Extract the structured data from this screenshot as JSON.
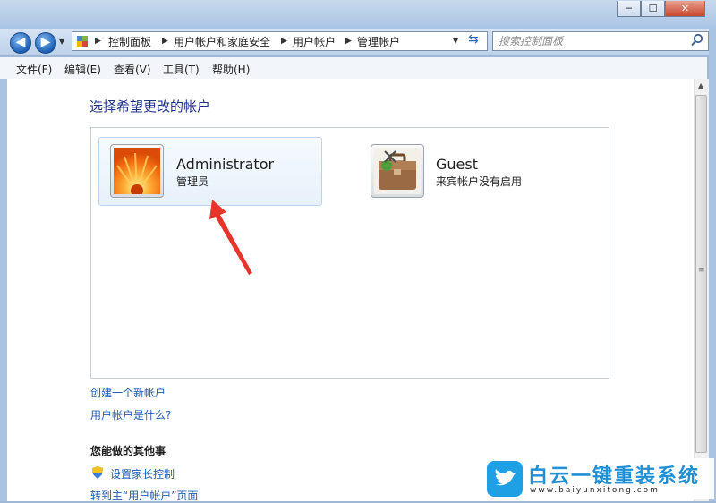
{
  "window": {
    "controls": {
      "minimize": "─",
      "maximize": "☐",
      "close": "✕"
    }
  },
  "nav": {
    "back": "◀",
    "forward": "▶",
    "breadcrumb": [
      "控制面板",
      "用户帐户和家庭安全",
      "用户帐户",
      "管理帐户"
    ],
    "search_placeholder": "搜索控制面板"
  },
  "menu": [
    "文件(F)",
    "编辑(E)",
    "查看(V)",
    "工具(T)",
    "帮助(H)"
  ],
  "main": {
    "heading": "选择希望更改的帐户",
    "accounts": [
      {
        "name": "Administrator",
        "role": "管理员",
        "avatar": "orange-flower-avatar"
      },
      {
        "name": "Guest",
        "role": "来宾帐户没有启用",
        "avatar": "briefcase-avatar"
      }
    ],
    "links": [
      "创建一个新帐户",
      "用户帐户是什么?"
    ],
    "other_title": "您能做的其他事",
    "other_items": [
      "设置家长控制",
      "转到主“用户帐户”页面"
    ]
  },
  "watermark": {
    "brand": "白云一键重装系统",
    "url": "www.baiyunxitong.com"
  },
  "colors": {
    "accent": "#1e5fb4",
    "heading": "#1e3287",
    "arrow": "#e8352b"
  }
}
